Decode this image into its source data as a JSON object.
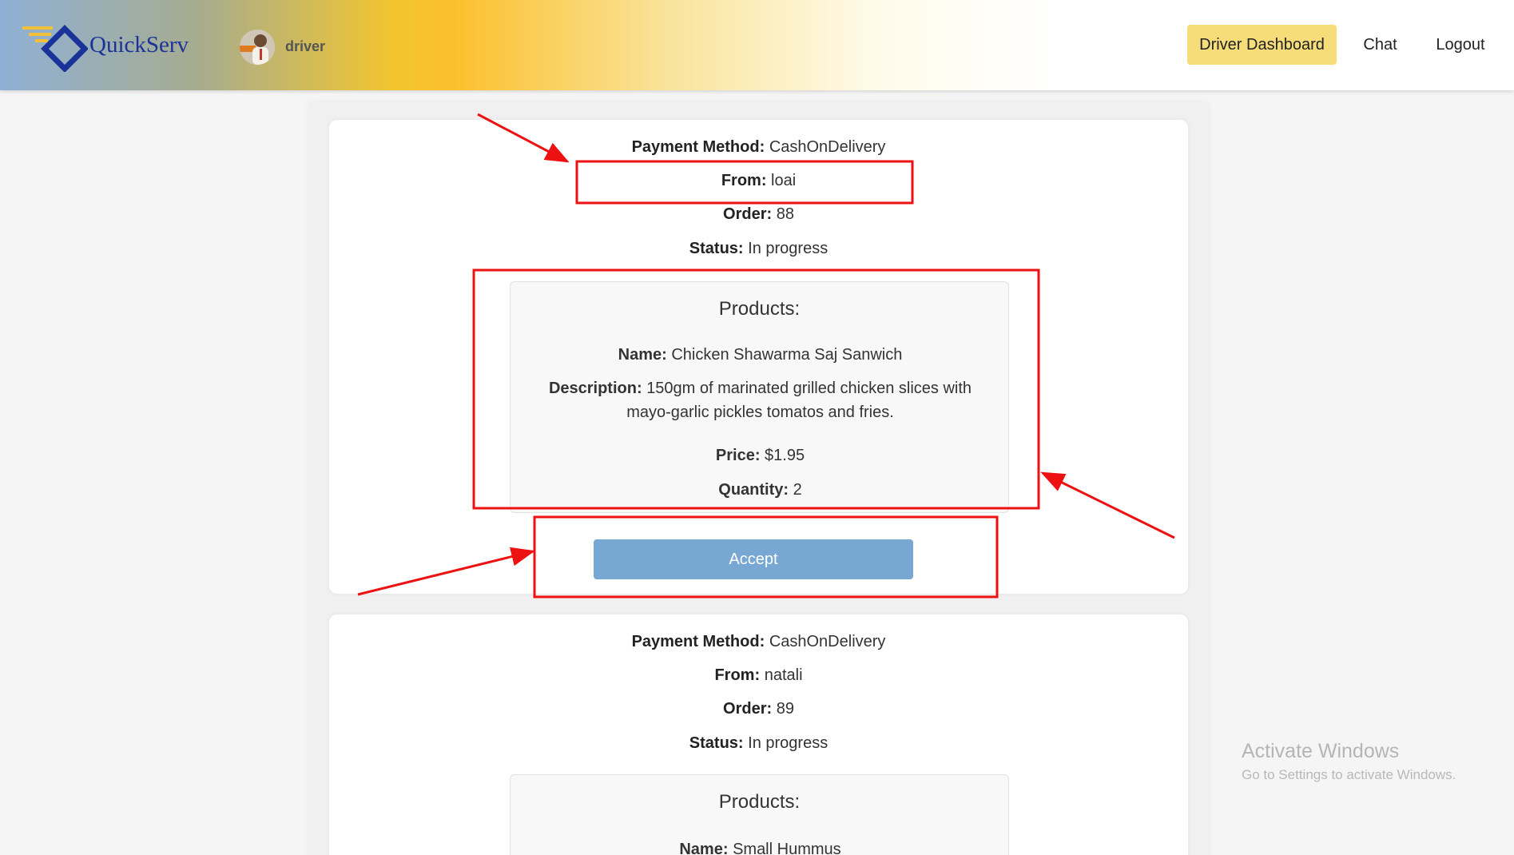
{
  "navbar": {
    "brand": "QuickServ",
    "username": "driver",
    "links": [
      "Driver Dashboard",
      "Chat",
      "Logout"
    ]
  },
  "orders": [
    {
      "payment_label": "Payment Method:",
      "payment_value": "CashOnDelivery",
      "from_label": "From:",
      "from_value": "loai",
      "order_label": "Order:",
      "order_value": "88",
      "status_label": "Status:",
      "status_value": "In progress",
      "products_title": "Products:",
      "product": {
        "name_label": "Name:",
        "name_value": "Chicken Shawarma Saj Sanwich",
        "description_label": "Description:",
        "description_value_line1": "150gm of marinated grilled chicken slices with",
        "description_value_line2": "mayo-garlic pickles tomatos and fries.",
        "price_label": "Price:",
        "price_value": "$1.95",
        "quantity_label": "Quantity:",
        "quantity_value": "2"
      },
      "accept_label": "Accept"
    },
    {
      "payment_label": "Payment Method:",
      "payment_value": "CashOnDelivery",
      "from_label": "From:",
      "from_value": "natali",
      "order_label": "Order:",
      "order_value": "89",
      "status_label": "Status:",
      "status_value": "In progress",
      "products_title": "Products:",
      "product": {
        "name_label": "Name:",
        "name_value": "Small Hummus"
      }
    }
  ],
  "watermark": {
    "title": "Activate Windows",
    "subtitle": "Go to Settings to activate Windows."
  },
  "colors": {
    "annotation": "#ee1111",
    "accept_button": "#78a7d3",
    "dashboard_button": "#f6dd79",
    "brand": "#1a3399"
  },
  "icons": [
    "quickserv-logo-icon",
    "driver-avatar-icon"
  ]
}
